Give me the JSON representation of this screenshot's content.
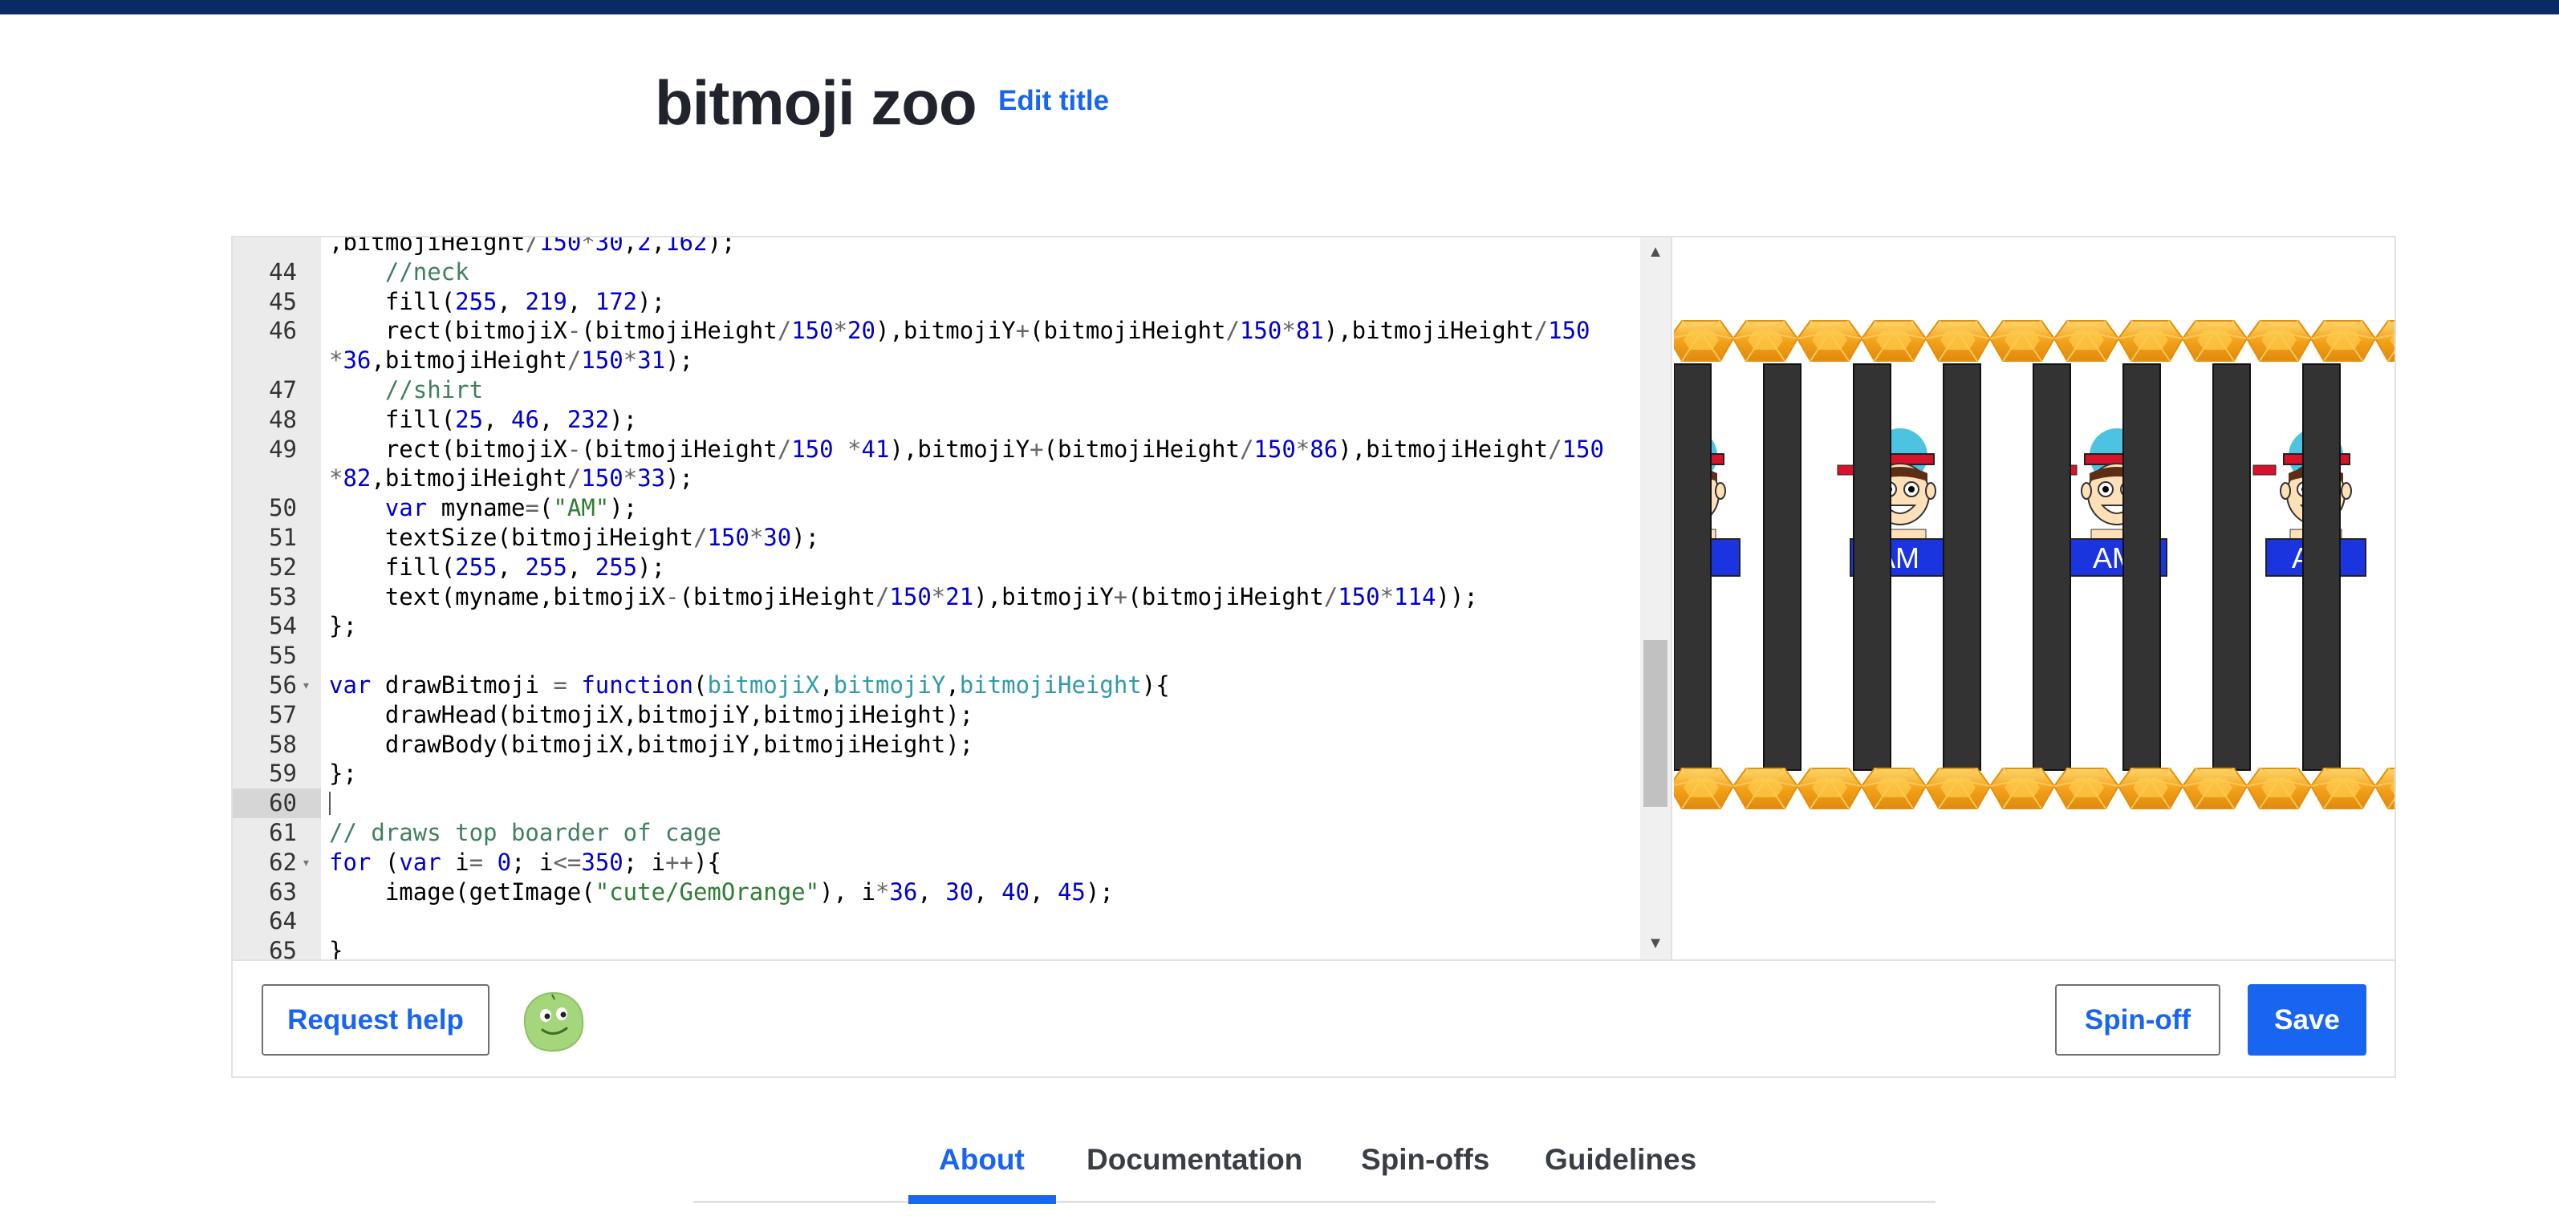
{
  "page": {
    "title": "bitmoji zoo",
    "edit_title_label": "Edit title"
  },
  "editor": {
    "lines": [
      {
        "num": "",
        "text": ",bitmojiHeight/150*30,2,162);",
        "fold": false,
        "partial": true
      },
      {
        "num": "44",
        "text": "    //neck",
        "fold": false
      },
      {
        "num": "45",
        "text": "    fill(255, 219, 172);",
        "fold": false
      },
      {
        "num": "46",
        "text": "    rect(bitmojiX-(bitmojiHeight/150*20),bitmojiY+(bitmojiHeight/150*81),bitmojiHeight/150",
        "fold": false
      },
      {
        "num": "",
        "text": "*36,bitmojiHeight/150*31);",
        "fold": false
      },
      {
        "num": "47",
        "text": "    //shirt",
        "fold": false
      },
      {
        "num": "48",
        "text": "    fill(25, 46, 232);",
        "fold": false
      },
      {
        "num": "49",
        "text": "    rect(bitmojiX-(bitmojiHeight/150 *41),bitmojiY+(bitmojiHeight/150*86),bitmojiHeight/150",
        "fold": false
      },
      {
        "num": "",
        "text": "*82,bitmojiHeight/150*33);",
        "fold": false
      },
      {
        "num": "50",
        "text": "    var myname=(\"AM\");",
        "fold": false
      },
      {
        "num": "51",
        "text": "    textSize(bitmojiHeight/150*30);",
        "fold": false
      },
      {
        "num": "52",
        "text": "    fill(255, 255, 255);",
        "fold": false
      },
      {
        "num": "53",
        "text": "    text(myname,bitmojiX-(bitmojiHeight/150*21),bitmojiY+(bitmojiHeight/150*114));",
        "fold": false
      },
      {
        "num": "54",
        "text": "};",
        "fold": false
      },
      {
        "num": "55",
        "text": "",
        "fold": false
      },
      {
        "num": "56",
        "text": "var drawBitmoji = function(bitmojiX,bitmojiY,bitmojiHeight){",
        "fold": true
      },
      {
        "num": "57",
        "text": "    drawHead(bitmojiX,bitmojiY,bitmojiHeight);",
        "fold": false
      },
      {
        "num": "58",
        "text": "    drawBody(bitmojiX,bitmojiY,bitmojiHeight);",
        "fold": false
      },
      {
        "num": "59",
        "text": "};",
        "fold": false
      },
      {
        "num": "60",
        "text": "",
        "fold": false,
        "active": true
      },
      {
        "num": "61",
        "text": "// draws top boarder of cage",
        "fold": false
      },
      {
        "num": "62",
        "text": "for (var i= 0; i<=350; i++){",
        "fold": true
      },
      {
        "num": "63",
        "text": "    image(getImage(\"cute/GemOrange\"), i*36, 30, 40, 45);",
        "fold": false
      },
      {
        "num": "64",
        "text": "",
        "fold": false
      },
      {
        "num": "65",
        "text": "}",
        "fold": false
      }
    ]
  },
  "canvas": {
    "bitmoji_label": "AM"
  },
  "toolbar": {
    "request_help_label": "Request help",
    "spin_off_label": "Spin-off",
    "save_label": "Save"
  },
  "tabs": [
    {
      "label": "About",
      "active": true
    },
    {
      "label": "Documentation",
      "active": false
    },
    {
      "label": "Spin-offs",
      "active": false
    },
    {
      "label": "Guidelines",
      "active": false
    }
  ],
  "colors": {
    "accent": "#1865f2",
    "topbar": "#0a2a66",
    "comment": "#3f7f5f",
    "keyword": "#0000cd",
    "number": "#0000cd",
    "string": "#2e7d32",
    "param": "#319aa8",
    "operator": "#666666"
  },
  "icons": {
    "avatar": "green-blob-avatar-icon",
    "scroll_up": "triangle-up-icon",
    "scroll_down": "triangle-down-icon",
    "fold": "fold-arrow-icon"
  }
}
